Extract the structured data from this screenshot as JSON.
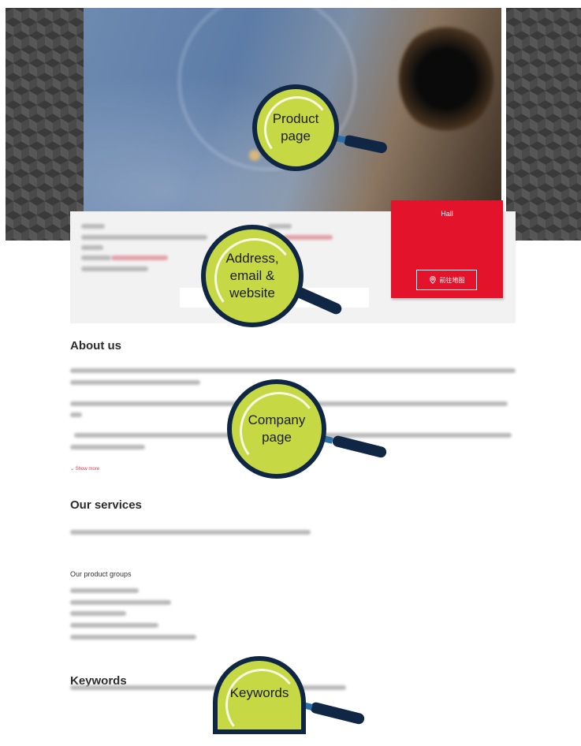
{
  "hero": {
    "image_alt": "product photo (blurred)"
  },
  "hall": {
    "label": "Hall",
    "map_button": "前往地图"
  },
  "sections": {
    "about": {
      "title": "About us",
      "show_more": "Show more"
    },
    "services": {
      "title": "Our services",
      "product_groups": "Our product groups"
    },
    "keywords": {
      "title": "Keywords"
    }
  },
  "callouts": {
    "product": {
      "line1": "Product",
      "line2": "page"
    },
    "address": {
      "line1": "Address,",
      "line2": "email &",
      "line3": "website"
    },
    "company": {
      "line1": "Company",
      "line2": "page"
    },
    "keywords": {
      "line1": "Keywords"
    }
  },
  "colors": {
    "accent_red": "#e2132a",
    "lens_green": "#c6d945",
    "lens_navy": "#0f2744"
  },
  "icons": {
    "map_button": "location-pin-icon"
  }
}
